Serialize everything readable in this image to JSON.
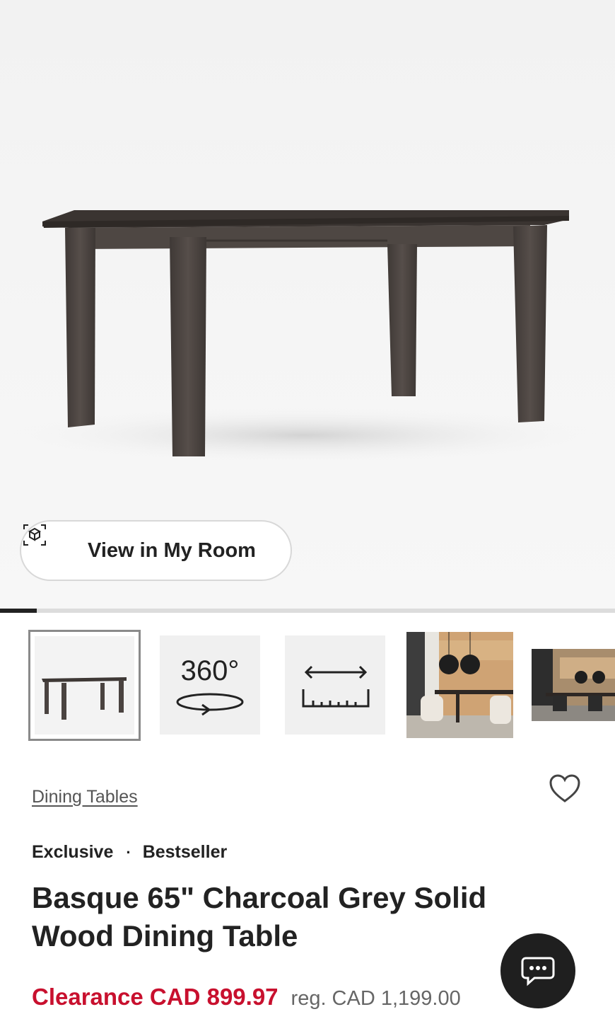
{
  "hero": {
    "view_in_room_label": "View in My Room",
    "gallery_progress": 0.06
  },
  "thumbnails": [
    {
      "kind": "product-image",
      "selected": true
    },
    {
      "kind": "360-view",
      "label": "360°"
    },
    {
      "kind": "dimensions"
    },
    {
      "kind": "room-image"
    },
    {
      "kind": "room-image"
    }
  ],
  "breadcrumb": "Dining Tables",
  "badges": {
    "first": "Exclusive",
    "separator": "·",
    "second": "Bestseller"
  },
  "product": {
    "title": "Basque 65\" Charcoal Grey Solid Wood Dining Table",
    "sale_price": "Clearance CAD 899.97",
    "regular_price": "reg. CAD 1,199.00"
  },
  "colors": {
    "sale": "#c8102e",
    "wood": "#4a4340",
    "chat_bg": "#1f1f1f"
  },
  "icons": {
    "room": "ar-cube-icon",
    "favorite": "heart-icon",
    "chat": "chat-bubble-icon"
  }
}
